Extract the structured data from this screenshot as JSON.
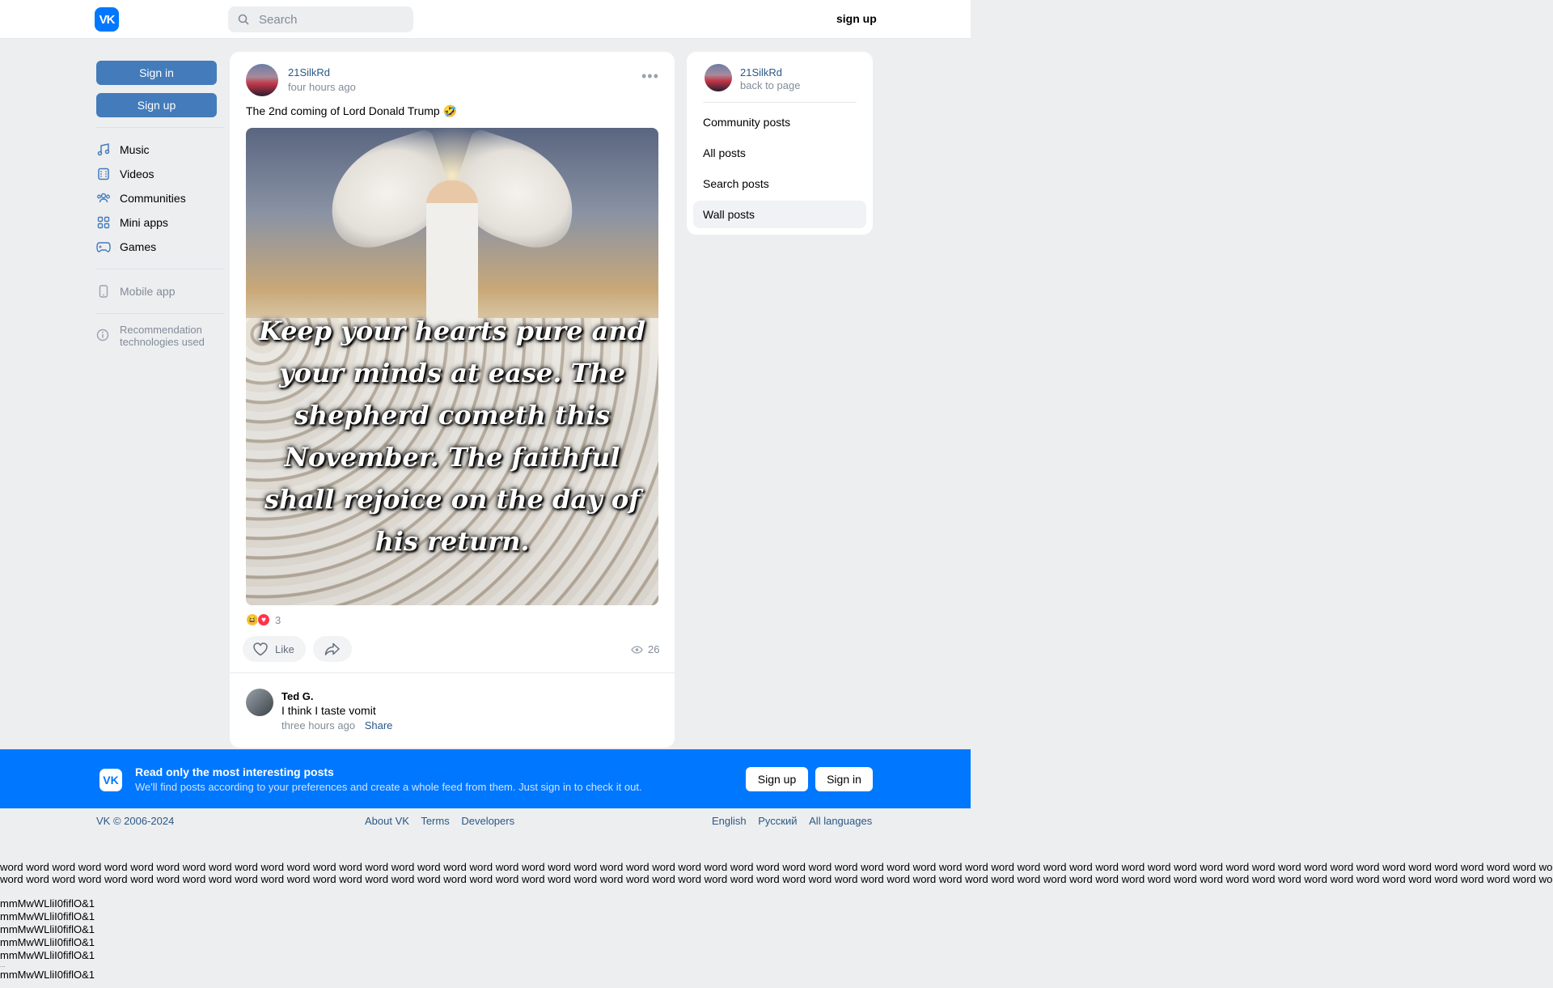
{
  "header": {
    "logo": "VK",
    "search_placeholder": "Search",
    "signup_link": "sign up"
  },
  "leftnav": {
    "sign_in": "Sign in",
    "sign_up": "Sign up",
    "items": [
      {
        "label": "Music",
        "icon": "music-icon"
      },
      {
        "label": "Videos",
        "icon": "videos-icon"
      },
      {
        "label": "Communities",
        "icon": "communities-icon"
      },
      {
        "label": "Mini apps",
        "icon": "mini-apps-icon"
      },
      {
        "label": "Games",
        "icon": "games-icon"
      }
    ],
    "mobile_app": "Mobile app",
    "recommendation": "Recommendation technologies used"
  },
  "post": {
    "author": "21SilkRd",
    "time": "four hours ago",
    "text": "The 2nd coming of Lord Donald Trump 🤣",
    "image_caption": "Keep your hearts pure and your minds at ease. The shepherd cometh this November. The faithful shall rejoice on the day of his return.",
    "reactions_count": "3",
    "like_label": "Like",
    "views": "26",
    "comment": {
      "author": "Ted G.",
      "text": "I think I taste vomit",
      "time": "three hours ago",
      "share": "Share"
    }
  },
  "right_panel": {
    "name": "21SilkRd",
    "back": "back to page",
    "items": [
      "Community posts",
      "All posts",
      "Search posts",
      "Wall posts"
    ],
    "active": "Wall posts"
  },
  "banner": {
    "title": "Read only the most interesting posts",
    "subtitle": "We'll find posts according to your preferences and create a whole feed from them. Just sign in to check it out.",
    "sign_up": "Sign up",
    "sign_in": "Sign in"
  },
  "footer": {
    "copyright": "VK © 2006-2024",
    "links": [
      "About VK",
      "Terms",
      "Developers"
    ],
    "languages": [
      "English",
      "Русский",
      "All languages"
    ]
  },
  "filler": {
    "words_line": "word word word word word word word word word word word word word word word word word word word word word word word word word word word word word word word word word word word word word word word word word word word word word word word word word word word word word word word word word word word word",
    "glyph_line": "mmMwWLliI0fiflO&1",
    "dots": "..."
  },
  "colors": {
    "accent": "#0077ff",
    "button_blue": "#447bba",
    "link": "#2a5885",
    "background": "#edeef0"
  }
}
